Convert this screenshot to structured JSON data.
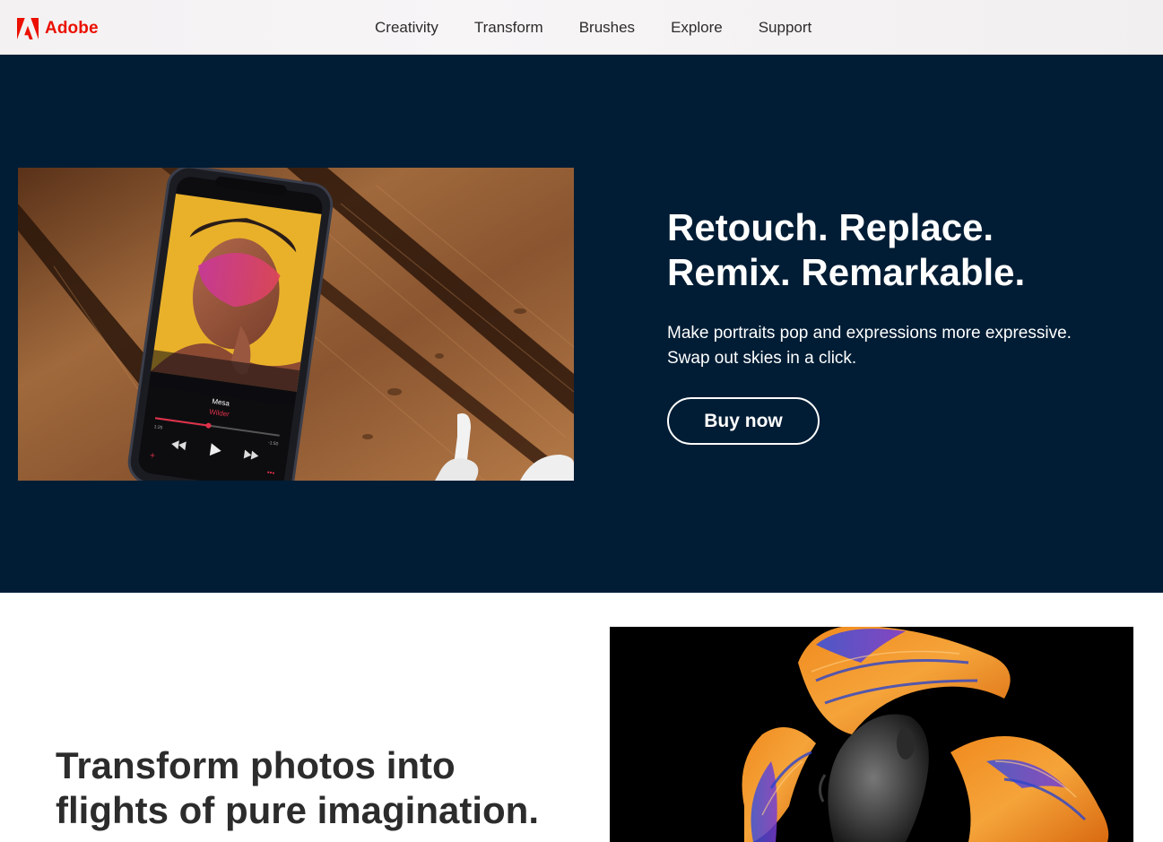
{
  "nav": {
    "brand": "Adobe",
    "links": [
      "Creativity",
      "Transform",
      "Brushes",
      "Explore",
      "Support"
    ]
  },
  "hero": {
    "headline_line1": "Retouch. Replace.",
    "headline_line2": "Remix. Remarkable.",
    "subtext_line1": "Make portraits pop and expressions more expressive.",
    "subtext_line2": "Swap out skies in a click.",
    "cta_label": "Buy now",
    "image": {
      "song_title": "Mesa",
      "song_artist": "Wilder",
      "time_elapsed": "1:25",
      "time_remaining": "-1:50"
    }
  },
  "section_two": {
    "headline_line1": "Transform photos into",
    "headline_line2": "flights of pure imagination."
  },
  "colors": {
    "brand_red": "#eb1000",
    "hero_bg": "#001d35",
    "text_dark": "#2c2c2c"
  }
}
